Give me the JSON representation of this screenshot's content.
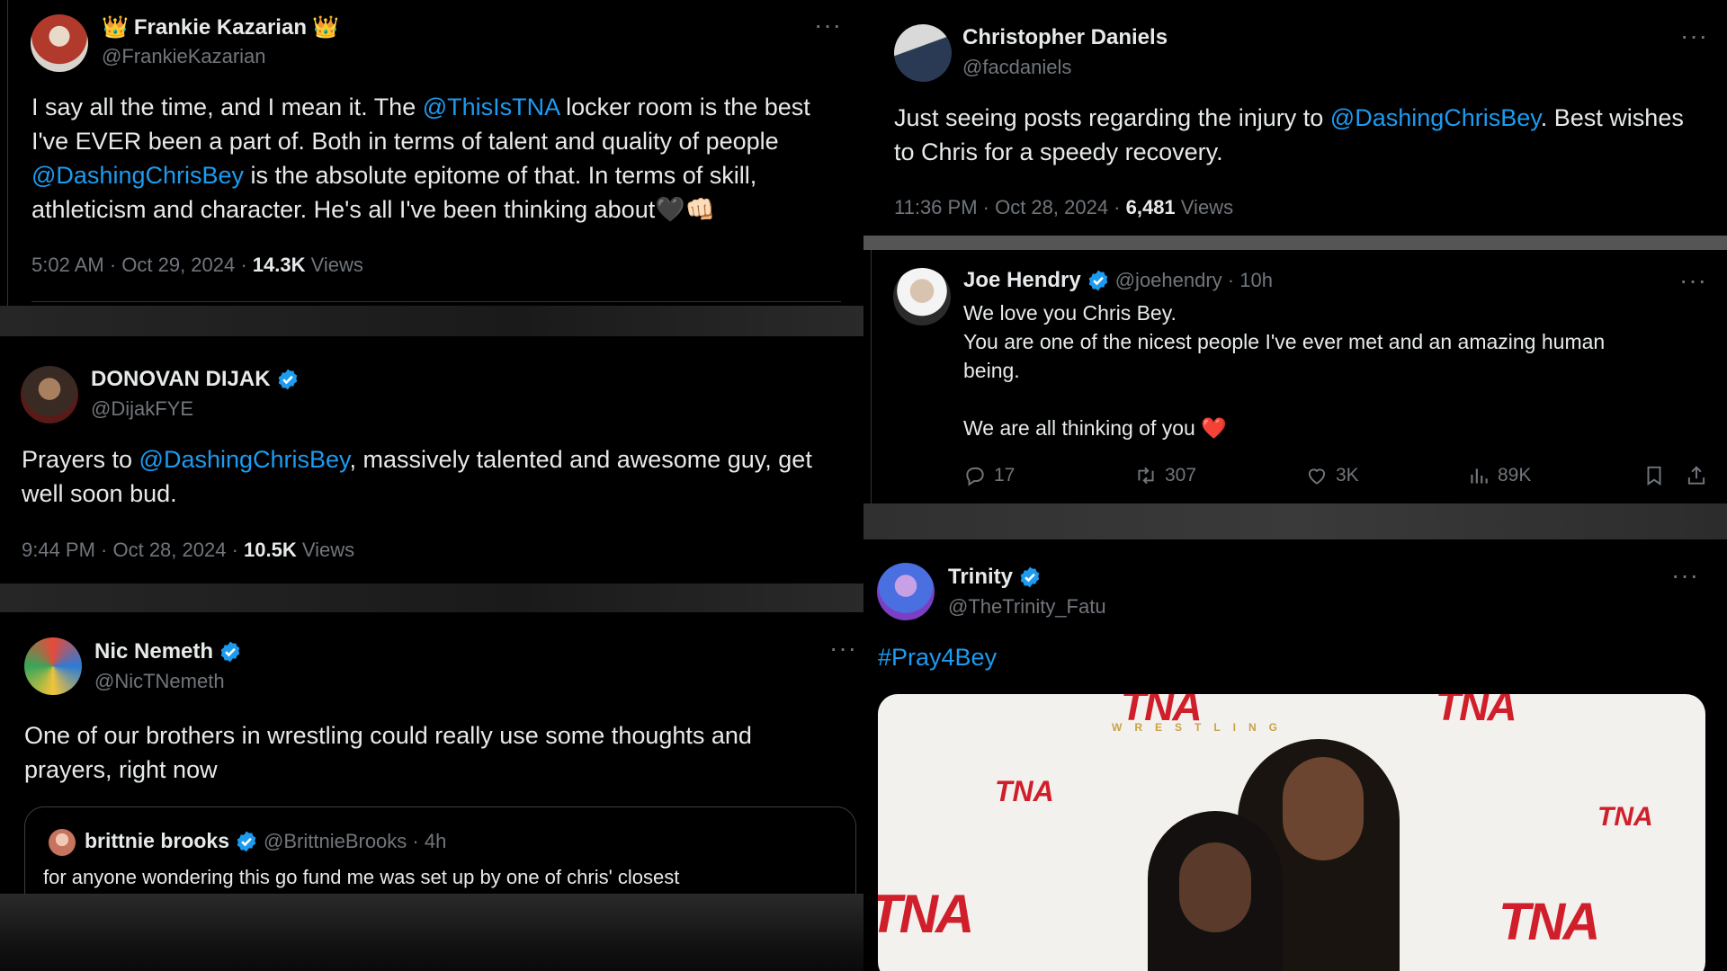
{
  "tweets": {
    "frankie": {
      "name": "Frankie Kazarian",
      "handle": "@FrankieKazarian",
      "line1a": "I say all the time, and I mean it. The ",
      "mention1": "@ThisIsTNA",
      "line1b": " locker room is the best",
      "line2": "I've EVER been a part of. Both in terms of talent and quality of people",
      "mention2": "@DashingChrisBey",
      "line3b": " is the absolute epitome of that. In terms of skill,",
      "line4": "athleticism and character. He's all I've been thinking about",
      "emoji": "🖤👊🏻",
      "time": "5:02 AM · Oct 29, 2024 · ",
      "views_count": "14.3K",
      "views_label": " Views"
    },
    "daniels": {
      "name": "Christopher Daniels",
      "handle": "@facdaniels",
      "line1a": "Just seeing posts regarding the injury to ",
      "mention": "@DashingChrisBey",
      "line1b": ". Best wishes",
      "line2": "to Chris for a speedy recovery.",
      "time": "11:36 PM · Oct 28, 2024 · ",
      "views_count": "6,481",
      "views_label": " Views"
    },
    "dijak": {
      "name": "DONOVAN DIJAK",
      "handle": "@DijakFYE",
      "line1a": "Prayers to ",
      "mention": "@DashingChrisBey",
      "line1b": ", massively talented and awesome guy, get",
      "line2": "well soon bud.",
      "time": "9:44 PM · Oct 28, 2024 · ",
      "views_count": "10.5K",
      "views_label": " Views"
    },
    "hendry": {
      "name": "Joe Hendry",
      "handle_time": "@joehendry · 10h",
      "line1": "We love you Chris Bey.",
      "line2": "You are one of the nicest people I've ever met and an amazing human",
      "line3": "being.",
      "line4": "We are all thinking of you",
      "heart": "❤️",
      "replies": "17",
      "reposts": "307",
      "likes": "3K",
      "views": "89K"
    },
    "nemeth": {
      "name": "Nic Nemeth",
      "handle": "@NicTNemeth",
      "line1": "One of our brothers in wrestling could really use some thoughts and",
      "line2": "prayers, right now",
      "quote_name": "brittnie brooks",
      "quote_handle_time": "@BrittnieBrooks · 4h",
      "quote_text": "for anyone wondering this go fund me was set up by one of chris' closest"
    },
    "trinity": {
      "name": "Trinity",
      "handle": "@TheTrinity_Fatu",
      "hashtag": "#Pray4Bey",
      "backdrop_logo": "TNA",
      "backdrop_sub": "WRESTLING"
    }
  },
  "colors": {
    "background": "#000000",
    "text": "#e7e9ea",
    "muted": "#71767b",
    "accent": "#1d9bf0",
    "verified": "#1d9bf0"
  },
  "icons": {
    "more": "more-horizontal-icon",
    "verified": "verified-badge-icon",
    "reply": "reply-icon",
    "repost": "repost-icon",
    "like": "heart-icon",
    "views": "analytics-icon",
    "bookmark": "bookmark-icon",
    "share": "share-icon"
  }
}
